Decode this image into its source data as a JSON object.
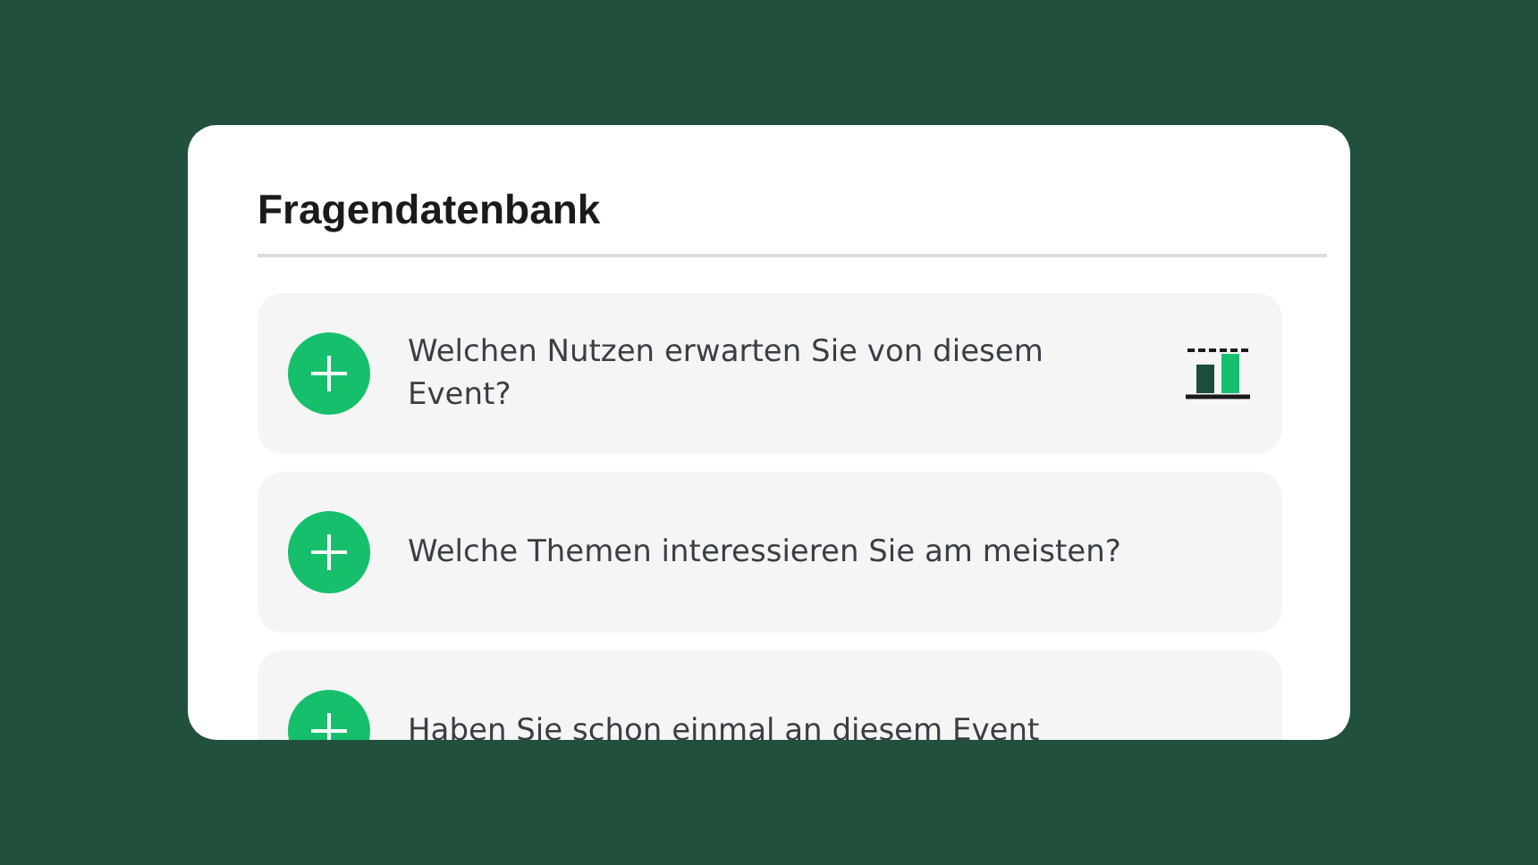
{
  "title": "Fragendatenbank",
  "questions": [
    {
      "text": "Welchen Nutzen erwarten Sie von diesem Event?",
      "kind": "chart"
    },
    {
      "text": "Welche Themen interessieren Sie am meisten?",
      "kind": "plain"
    },
    {
      "text": "Haben Sie schon einmal an diesem Event",
      "kind": "plain"
    }
  ]
}
